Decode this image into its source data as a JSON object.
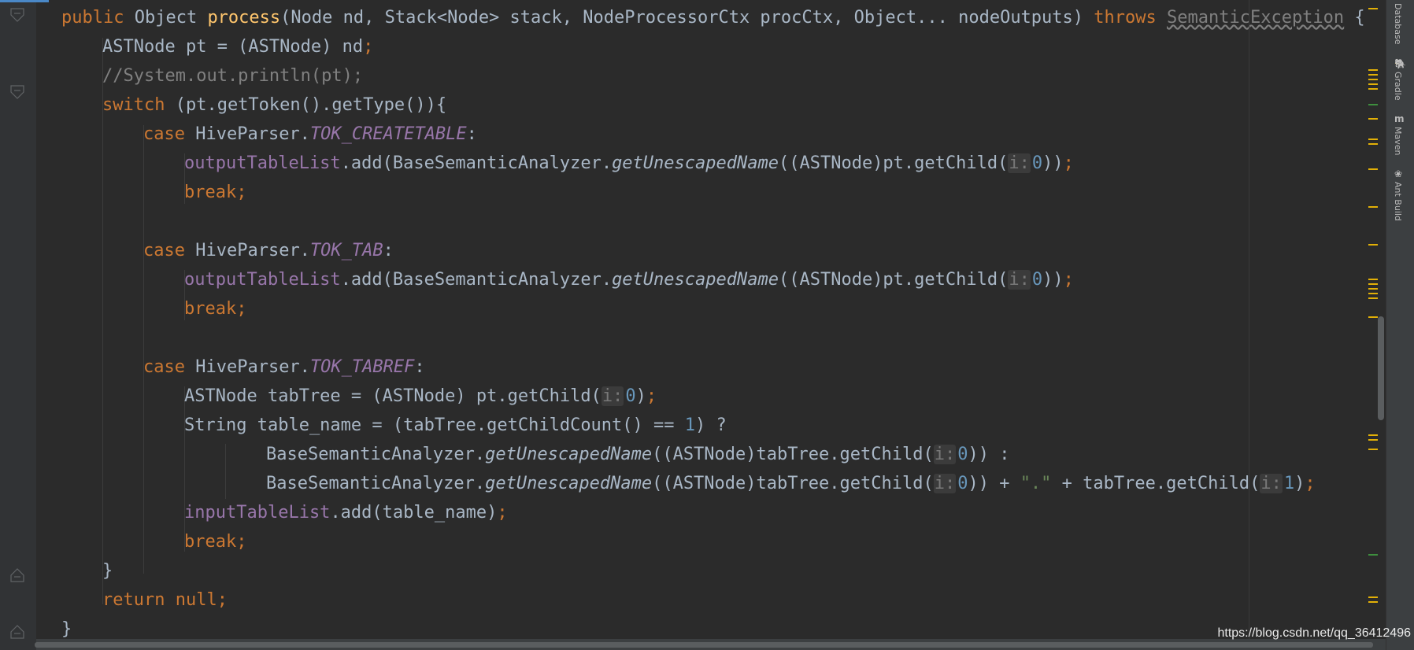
{
  "editor": {
    "lines": [
      {
        "indent": 0,
        "tokens": [
          {
            "t": "public ",
            "c": "k"
          },
          {
            "t": "Object "
          },
          {
            "t": "process",
            "c": "f"
          },
          {
            "t": "(Node nd, Stack<Node> stack, NodeProcessorCtx procCtx, Object... nodeOutputs) "
          },
          {
            "t": "throws ",
            "c": "k"
          },
          {
            "t": "SemanticException",
            "c": "u"
          },
          {
            "t": " {"
          }
        ]
      },
      {
        "indent": 1,
        "tokens": [
          {
            "t": "ASTNode pt = (ASTNode) nd"
          },
          {
            "t": ";",
            "c": "k"
          }
        ]
      },
      {
        "indent": 1,
        "tokens": [
          {
            "t": "//System.out.println(pt);",
            "c": "c"
          }
        ]
      },
      {
        "indent": 1,
        "tokens": [
          {
            "t": "switch ",
            "c": "k"
          },
          {
            "t": "(pt.getToken().getType()){"
          }
        ]
      },
      {
        "indent": 2,
        "tokens": [
          {
            "t": "case ",
            "c": "k"
          },
          {
            "t": "HiveParser."
          },
          {
            "t": "TOK_CREATETABLE",
            "c": "sf"
          },
          {
            "t": ":"
          }
        ]
      },
      {
        "indent": 3,
        "tokens": [
          {
            "t": "outputTableList",
            "c": "fld"
          },
          {
            "t": ".add(BaseSemanticAnalyzer."
          },
          {
            "t": "getUnescapedName",
            "c": "sm"
          },
          {
            "t": "((ASTNode)pt.getChild("
          },
          {
            "t": "i:",
            "c": "hint"
          },
          {
            "t": "0",
            "c": "n"
          },
          {
            "t": "))"
          },
          {
            "t": ";",
            "c": "k"
          }
        ]
      },
      {
        "indent": 3,
        "tokens": [
          {
            "t": "break;",
            "c": "k"
          }
        ]
      },
      {
        "indent": 0,
        "tokens": []
      },
      {
        "indent": 2,
        "tokens": [
          {
            "t": "case ",
            "c": "k"
          },
          {
            "t": "HiveParser."
          },
          {
            "t": "TOK_TAB",
            "c": "sf"
          },
          {
            "t": ":"
          }
        ]
      },
      {
        "indent": 3,
        "tokens": [
          {
            "t": "outputTableList",
            "c": "fld"
          },
          {
            "t": ".add(BaseSemanticAnalyzer."
          },
          {
            "t": "getUnescapedName",
            "c": "sm"
          },
          {
            "t": "((ASTNode)pt.getChild("
          },
          {
            "t": "i:",
            "c": "hint"
          },
          {
            "t": "0",
            "c": "n"
          },
          {
            "t": "))"
          },
          {
            "t": ";",
            "c": "k"
          }
        ]
      },
      {
        "indent": 3,
        "tokens": [
          {
            "t": "break;",
            "c": "k"
          }
        ]
      },
      {
        "indent": 0,
        "tokens": []
      },
      {
        "indent": 2,
        "tokens": [
          {
            "t": "case ",
            "c": "k"
          },
          {
            "t": "HiveParser."
          },
          {
            "t": "TOK_TABREF",
            "c": "sf"
          },
          {
            "t": ":"
          }
        ]
      },
      {
        "indent": 3,
        "tokens": [
          {
            "t": "ASTNode tabTree = (ASTNode) pt.getChild("
          },
          {
            "t": "i:",
            "c": "hint"
          },
          {
            "t": "0",
            "c": "n"
          },
          {
            "t": ")"
          },
          {
            "t": ";",
            "c": "k"
          }
        ]
      },
      {
        "indent": 3,
        "tokens": [
          {
            "t": "String table_name = (tabTree.getChildCount() == "
          },
          {
            "t": "1",
            "c": "n"
          },
          {
            "t": ") ?"
          }
        ]
      },
      {
        "indent": 5,
        "tokens": [
          {
            "t": "BaseSemanticAnalyzer."
          },
          {
            "t": "getUnescapedName",
            "c": "sm"
          },
          {
            "t": "((ASTNode)tabTree.getChild("
          },
          {
            "t": "i:",
            "c": "hint"
          },
          {
            "t": "0",
            "c": "n"
          },
          {
            "t": ")) :"
          }
        ]
      },
      {
        "indent": 5,
        "tokens": [
          {
            "t": "BaseSemanticAnalyzer."
          },
          {
            "t": "getUnescapedName",
            "c": "sm"
          },
          {
            "t": "((ASTNode)tabTree.getChild("
          },
          {
            "t": "i:",
            "c": "hint"
          },
          {
            "t": "0",
            "c": "n"
          },
          {
            "t": ")) + "
          },
          {
            "t": "\".\"",
            "c": "s"
          },
          {
            "t": " + tabTree.getChild("
          },
          {
            "t": "i:",
            "c": "hint"
          },
          {
            "t": "1",
            "c": "n"
          },
          {
            "t": ")"
          },
          {
            "t": ";",
            "c": "k"
          }
        ]
      },
      {
        "indent": 3,
        "tokens": [
          {
            "t": "inputTableList",
            "c": "fld"
          },
          {
            "t": ".add(table_name)"
          },
          {
            "t": ";",
            "c": "k"
          }
        ]
      },
      {
        "indent": 3,
        "tokens": [
          {
            "t": "break;",
            "c": "k"
          }
        ]
      },
      {
        "indent": 1,
        "tokens": [
          {
            "t": "}"
          }
        ]
      },
      {
        "indent": 1,
        "tokens": [
          {
            "t": "return null;",
            "c": "k"
          }
        ]
      },
      {
        "indent": 0,
        "tokens": [
          {
            "t": "}"
          }
        ]
      }
    ]
  },
  "tool_windows": [
    {
      "label": "Database",
      "icon": "database-icon"
    },
    {
      "label": "Gradle",
      "icon": "gradle-icon"
    },
    {
      "label": "Maven",
      "icon": "maven-icon"
    },
    {
      "label": "Ant Build",
      "icon": "ant-icon"
    }
  ],
  "watermark": "https://blog.csdn.net/qq_36412496",
  "colors": {
    "background": "#2b2b2b",
    "keyword": "#cc7832",
    "method_decl": "#ffc66d",
    "field": "#9876aa",
    "number": "#6897bb",
    "string": "#6a8759",
    "comment": "#808080",
    "text": "#a9b7c6",
    "marker_warning": "#e2b007",
    "marker_ok": "#3e8f3e"
  }
}
